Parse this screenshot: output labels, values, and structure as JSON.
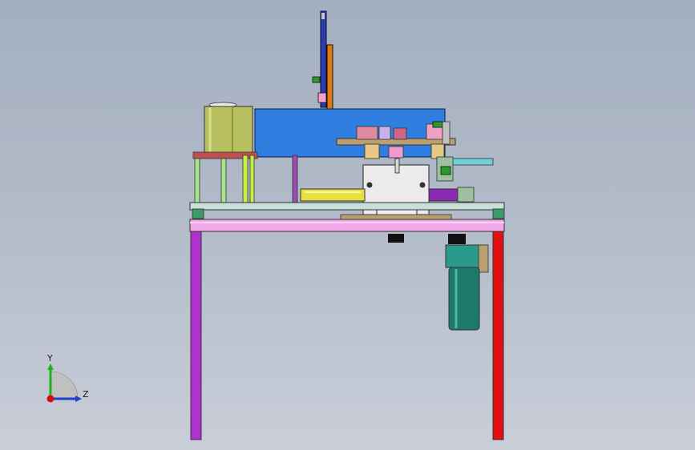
{
  "viewport": {
    "background_top": "#a3afc0",
    "background_bottom": "#c9ced8"
  },
  "triad": {
    "y_label": "Y",
    "z_label": "Z",
    "y_color": "#22b022",
    "z_color": "#1f3fd0",
    "x_color": "#d01010"
  },
  "model": {
    "frame_left_leg_color": "#b030d0",
    "frame_right_leg_color": "#e01010",
    "top_rail_color": "#f0a8e8",
    "housing_color": "#2f7fe0",
    "tank_color": "#b8c060",
    "motor_color": "#1d7a6a",
    "cylinder_color": "#e8e040"
  }
}
